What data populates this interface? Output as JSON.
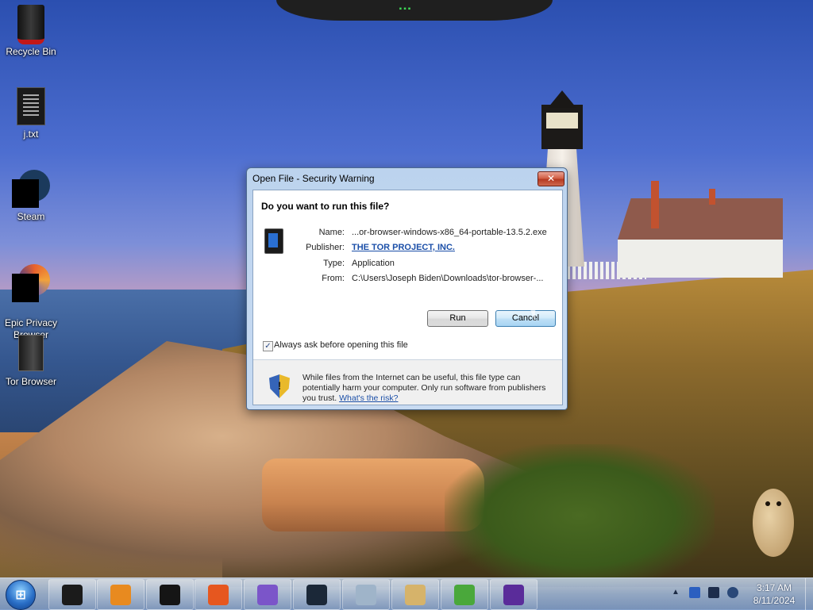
{
  "desktop": {
    "icons": [
      {
        "label": "Recycle Bin",
        "icon": "recycle-bin-icon"
      },
      {
        "label": "j.txt",
        "icon": "text-file-icon"
      },
      {
        "label": "Steam",
        "icon": "steam-icon"
      },
      {
        "label": "Epic Privacy\nBrowser",
        "icon": "epic-privacy-browser-icon"
      },
      {
        "label": "Tor Browser",
        "icon": "tor-browser-icon"
      }
    ]
  },
  "dialog": {
    "title": "Open File - Security Warning",
    "close_glyph": "✕",
    "question": "Do you want to run this file?",
    "file_icon": "tor-browser-file-icon",
    "fields": {
      "name_label": "Name:",
      "name_value": "...or-browser-windows-x86_64-portable-13.5.2.exe",
      "publisher_label": "Publisher:",
      "publisher_value": "THE TOR PROJECT, INC.",
      "type_label": "Type:",
      "type_value": "Application",
      "from_label": "From:",
      "from_value": "C:\\Users\\Joseph Biden\\Downloads\\tor-browser-..."
    },
    "buttons": {
      "run": "Run",
      "cancel": "Cancel"
    },
    "checkbox": {
      "checked": true,
      "mark": "✓",
      "label": "Always ask before opening this file"
    },
    "info": {
      "icon": "security-shield-icon",
      "icon_glyph": "!",
      "text": "While files from the Internet can be useful, this file type can potentially harm your computer. Only run software from publishers you trust.",
      "link": "What's the risk?"
    }
  },
  "taskbar": {
    "start_glyph": "⊞",
    "buttons": [
      {
        "name": "taskbar-item-1",
        "icon": "black-box-app-icon",
        "color": "#1b1b1b"
      },
      {
        "name": "taskbar-item-2",
        "icon": "media-player-icon",
        "color": "#e88a1f"
      },
      {
        "name": "taskbar-item-3",
        "icon": "tor-file-icon",
        "color": "#151515"
      },
      {
        "name": "taskbar-item-4",
        "icon": "firefox-icon",
        "color": "#e6571f"
      },
      {
        "name": "taskbar-item-5",
        "icon": "epic-browser-icon",
        "color": "#7b55c9"
      },
      {
        "name": "taskbar-item-6",
        "icon": "steam-icon",
        "color": "#1b2838"
      },
      {
        "name": "taskbar-item-7",
        "icon": "calculator-icon",
        "color": "#9fb4c9"
      },
      {
        "name": "taskbar-item-8",
        "icon": "paint-icon",
        "color": "#d6b36a"
      },
      {
        "name": "taskbar-item-9",
        "icon": "windows-update-icon",
        "color": "#4aa83b"
      },
      {
        "name": "taskbar-item-10",
        "icon": "tor-browser-icon",
        "color": "#5a2c9a"
      }
    ],
    "tray": {
      "arrow": "▲",
      "icons": [
        "bluetooth-icon",
        "network-icon",
        "volume-icon"
      ]
    },
    "clock": {
      "time": "3:17 AM",
      "date": "8/11/2024"
    }
  },
  "top_gadget": {
    "indicator": "▪▪▪"
  }
}
